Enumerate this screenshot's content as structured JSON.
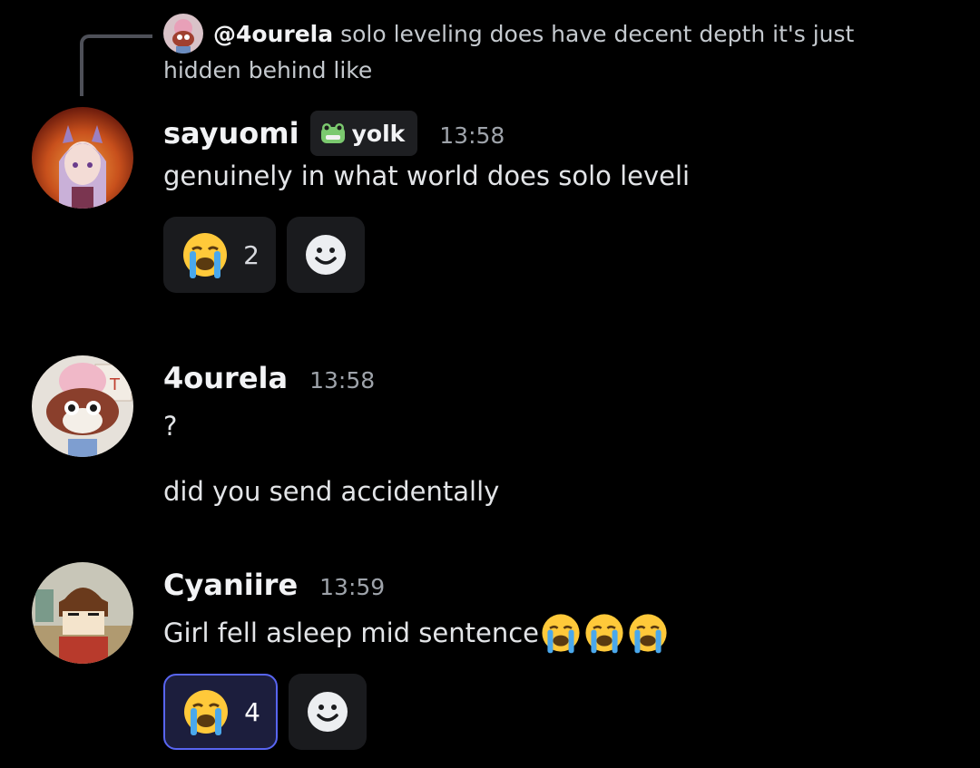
{
  "reply": {
    "author": "@4ourela",
    "text": "solo leveling does have decent depth it's just hidden behind like"
  },
  "messages": [
    {
      "username": "sayuomi",
      "tag": "yolk",
      "timestamp": "13:58",
      "lines": [
        "genuinely in what world does solo leveli"
      ],
      "reaction": {
        "emoji": "loudly-crying-face",
        "count": "2"
      }
    },
    {
      "username": "4ourela",
      "timestamp": "13:58",
      "lines": [
        "?",
        "did you send accidentally"
      ]
    },
    {
      "username": "Cyaniire",
      "timestamp": "13:59",
      "lines": [
        "Girl fell asleep mid sentence"
      ],
      "reaction": {
        "emoji": "loudly-crying-face",
        "count": "4"
      }
    }
  ],
  "colors": {
    "background": "#000000",
    "reaction_active_border": "#5865f2",
    "timestamp": "#9ea3aa"
  },
  "icons": {
    "add_reaction": "smiley-face-icon",
    "tag_icon": "frog-icon"
  }
}
